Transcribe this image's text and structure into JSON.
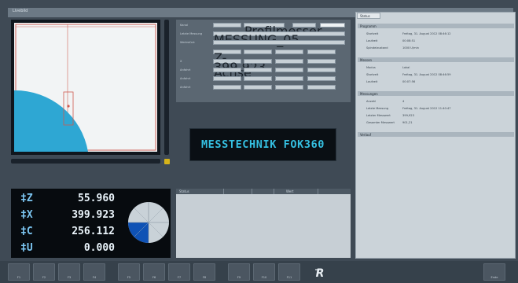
{
  "window": {
    "title": "Livebild"
  },
  "plot": {
    "colors": {
      "background": "#f2f4f5",
      "frame": "#d0655b",
      "shape": "#2ea7d3",
      "marker": "#cf5a4f"
    }
  },
  "form": {
    "rows": [
      {
        "label": "Kanal",
        "fields": [
          {
            "value": ""
          },
          {
            "value": "Profilmesser"
          },
          {
            "value": ""
          },
          {
            "value": ""
          }
        ]
      },
      {
        "label": "Letzte Messung",
        "fields": [
          {
            "value": "MESSUNG_05"
          }
        ]
      },
      {
        "label": "Werkstück",
        "fields": [
          {
            "value": ""
          }
        ]
      },
      {
        "label": "",
        "fields": [
          {
            "value": "Z-Achse"
          },
          {
            "value": ""
          },
          {
            "value": ""
          },
          {
            "value": ""
          }
        ]
      },
      {
        "label": "X",
        "fields": [
          {
            "value": "399,923"
          },
          {
            "value": ""
          },
          {
            "value": ""
          },
          {
            "value": ""
          }
        ]
      },
      {
        "label": "Anfahrt",
        "fields": [
          {
            "value": ""
          },
          {
            "value": ""
          },
          {
            "value": ""
          },
          {
            "value": ""
          }
        ]
      },
      {
        "label": "Anfahrt",
        "fields": [
          {
            "value": ""
          },
          {
            "value": ""
          },
          {
            "value": ""
          },
          {
            "value": ""
          }
        ]
      },
      {
        "label": "Anfahrt",
        "fields": [
          {
            "value": ""
          },
          {
            "value": ""
          },
          {
            "value": ""
          },
          {
            "value": ""
          }
        ]
      }
    ]
  },
  "banner": {
    "text": "MESSTECHNIK FOK360",
    "color": "#35c0e2"
  },
  "dro": {
    "axes": [
      {
        "axis": "‡Z",
        "value": "55.960"
      },
      {
        "axis": "‡X",
        "value": "399.923"
      },
      {
        "axis": "‡C",
        "value": "256.112"
      },
      {
        "axis": "‡U",
        "value": "0.000"
      }
    ],
    "gauge_fraction": 0.25,
    "colors": {
      "axis": "#7cc6f2",
      "value": "#eaf4fb",
      "gauge_fill": "#0f52b5",
      "gauge_bg": "#c9d2d8"
    }
  },
  "table": {
    "headers": [
      "Status",
      "",
      "",
      "",
      "Wert",
      ""
    ]
  },
  "status": {
    "tab": "Status",
    "sections": [
      {
        "title": "Programm",
        "rows": [
          {
            "label": "Startzeit",
            "value": "Freitag, 31. August 2012 08:46:12"
          },
          {
            "label": "Laufzeit",
            "value": "00:08:51"
          },
          {
            "label": "Spindelzustand",
            "value": "1000 U/min"
          }
        ]
      },
      {
        "title": "Messen",
        "rows": [
          {
            "label": "Modus",
            "value": "Lokal"
          },
          {
            "label": "Startzeit",
            "value": "Freitag, 31. August 2012 08:46:59"
          },
          {
            "label": "Laufzeit",
            "value": "00:07:56"
          }
        ]
      },
      {
        "title": "Messungen",
        "rows": [
          {
            "label": "Anzahl",
            "value": "4"
          },
          {
            "label": "Letzte Messung",
            "value": "Freitag, 31. August 2012 11:40:47"
          },
          {
            "label": "Letzter Messwert",
            "value": "399,923"
          },
          {
            "label": "Gesamter Messwert",
            "value": "901,21"
          }
        ]
      },
      {
        "title": "Verlauf",
        "rows": []
      }
    ]
  },
  "toolbar": {
    "buttons": [
      "F1",
      "F2",
      "F3",
      "F4",
      "F5",
      "F6",
      "F7",
      "F8",
      "F9",
      "F10",
      "F11"
    ],
    "end_button": "Ende"
  }
}
